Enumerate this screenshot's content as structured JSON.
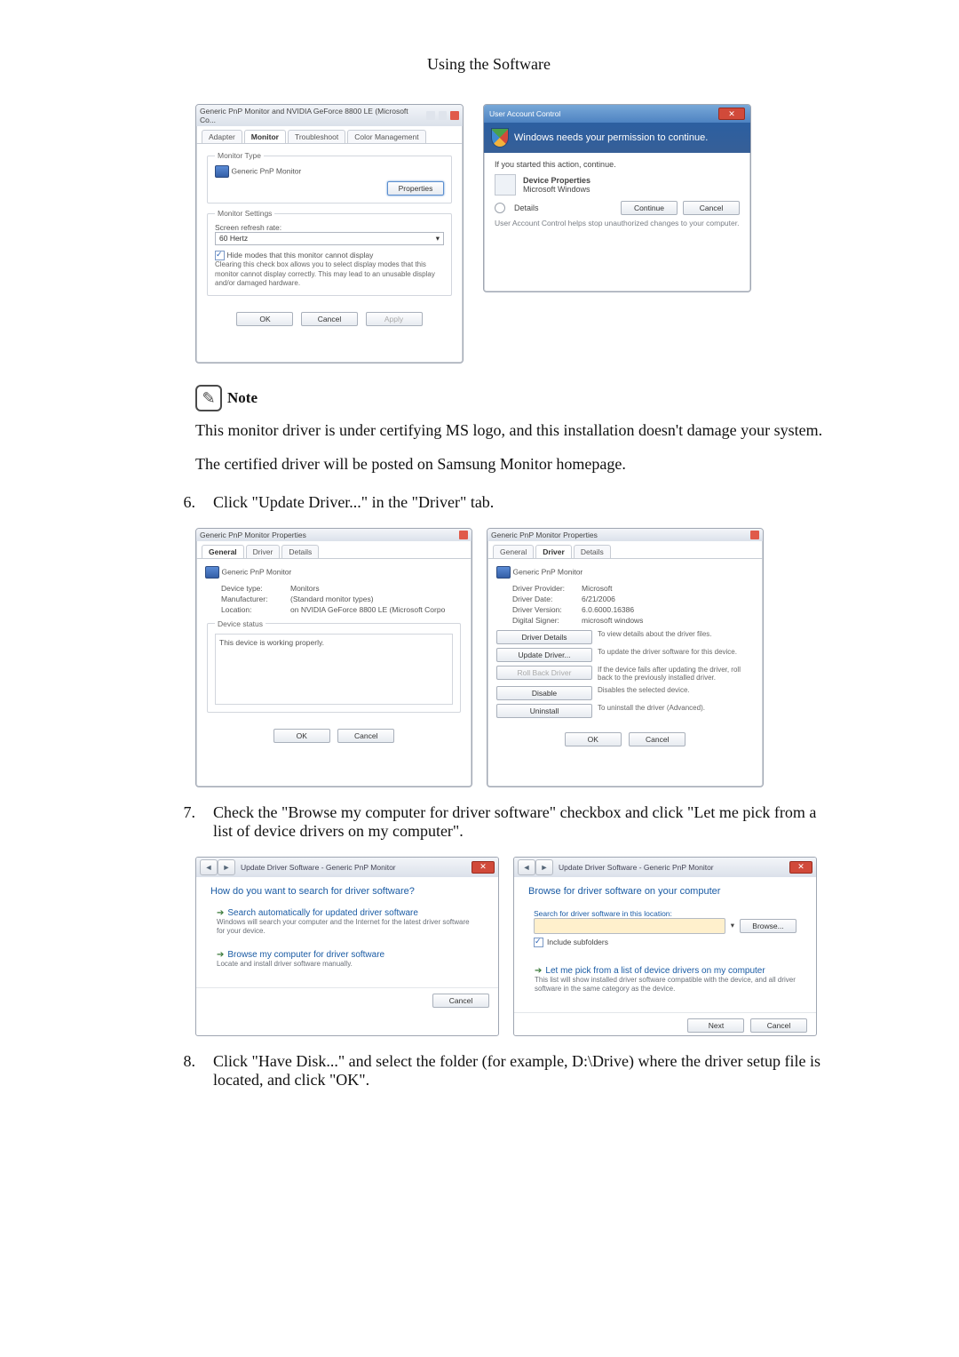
{
  "page_title": "Using the Software",
  "monitor_dialog": {
    "title": "Generic PnP Monitor and NVIDIA GeForce 8800 LE (Microsoft Co...",
    "tabs": {
      "adapter": "Adapter",
      "monitor": "Monitor",
      "troubleshoot": "Troubleshoot",
      "color": "Color Management"
    },
    "monitor_type_legend": "Monitor Type",
    "monitor_type_value": "Generic PnP Monitor",
    "properties_btn": "Properties",
    "monitor_settings_legend": "Monitor Settings",
    "refresh_label": "Screen refresh rate:",
    "refresh_value": "60 Hertz",
    "hide_modes_label": "Hide modes that this monitor cannot display",
    "hide_modes_desc": "Clearing this check box allows you to select display modes that this monitor cannot display correctly. This may lead to an unusable display and/or damaged hardware.",
    "ok": "OK",
    "cancel": "Cancel",
    "apply": "Apply"
  },
  "uac_dialog": {
    "title": "User Account Control",
    "banner": "Windows needs your permission to continue.",
    "started": "If you started this action, continue.",
    "item_title": "Device Properties",
    "item_sub": "Microsoft Windows",
    "details": "Details",
    "continue": "Continue",
    "cancel": "Cancel",
    "footer": "User Account Control helps stop unauthorized changes to your computer."
  },
  "note": {
    "label": "Note"
  },
  "note_line1": "This monitor driver is under certifying MS logo, and this installation doesn't damage your system.",
  "note_line2": "The certified driver will be posted on Samsung Monitor homepage.",
  "step6": {
    "num": "6.",
    "text": "Click \"Update Driver...\" in the \"Driver\" tab."
  },
  "drv_props_general": {
    "title": "Generic PnP Monitor Properties",
    "tabs": {
      "general": "General",
      "driver": "Driver",
      "details": "Details"
    },
    "name": "Generic PnP Monitor",
    "k_type": "Device type:",
    "v_type": "Monitors",
    "k_manu": "Manufacturer:",
    "v_manu": "(Standard monitor types)",
    "k_loc": "Location:",
    "v_loc": "on NVIDIA GeForce 8800 LE (Microsoft Corpo",
    "status_legend": "Device status",
    "status_text": "This device is working properly.",
    "ok": "OK",
    "cancel": "Cancel"
  },
  "drv_props_driver": {
    "title": "Generic PnP Monitor Properties",
    "tabs": {
      "general": "General",
      "driver": "Driver",
      "details": "Details"
    },
    "name": "Generic PnP Monitor",
    "k_provider": "Driver Provider:",
    "v_provider": "Microsoft",
    "k_date": "Driver Date:",
    "v_date": "6/21/2006",
    "k_version": "Driver Version:",
    "v_version": "6.0.6000.16386",
    "k_signer": "Digital Signer:",
    "v_signer": "microsoft windows",
    "btn_details": "Driver Details",
    "desc_details": "To view details about the driver files.",
    "btn_update": "Update Driver...",
    "desc_update": "To update the driver software for this device.",
    "btn_rollback": "Roll Back Driver",
    "desc_rollback": "If the device fails after updating the driver, roll back to the previously installed driver.",
    "btn_disable": "Disable",
    "desc_disable": "Disables the selected device.",
    "btn_uninstall": "Uninstall",
    "desc_uninstall": "To uninstall the driver (Advanced).",
    "ok": "OK",
    "cancel": "Cancel"
  },
  "step7": {
    "num": "7.",
    "text": "Check the \"Browse my computer for driver software\" checkbox and click \"Let me pick from a list of device drivers on my computer\"."
  },
  "wizard_how": {
    "breadcrumb": "Update Driver Software - Generic PnP Monitor",
    "heading": "How do you want to search for driver software?",
    "opt1_title": "Search automatically for updated driver software",
    "opt1_desc": "Windows will search your computer and the Internet for the latest driver software for your device.",
    "opt2_title": "Browse my computer for driver software",
    "opt2_desc": "Locate and install driver software manually.",
    "cancel": "Cancel"
  },
  "wizard_browse": {
    "breadcrumb": "Update Driver Software - Generic PnP Monitor",
    "heading": "Browse for driver software on your computer",
    "field_label": "Search for driver software in this location:",
    "path_value": "",
    "browse": "Browse...",
    "include_sub": "Include subfolders",
    "opt_title": "Let me pick from a list of device drivers on my computer",
    "opt_desc": "This list will show installed driver software compatible with the device, and all driver software in the same category as the device.",
    "next": "Next",
    "cancel": "Cancel"
  },
  "step8": {
    "num": "8.",
    "text": "Click \"Have Disk...\" and select the folder (for example, D:\\Drive) where the driver setup file is located, and click \"OK\"."
  }
}
